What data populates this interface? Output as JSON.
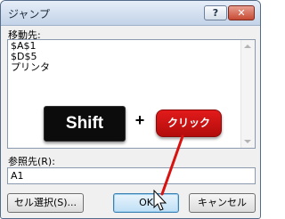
{
  "window": {
    "title": "ジャンプ",
    "help_label": "?",
    "close_label": "✕"
  },
  "goto": {
    "label": "移動先:",
    "items": [
      "$A$1",
      "$D$5",
      "プリンタ"
    ]
  },
  "overlay": {
    "key_label": "Shift",
    "plus": "+",
    "click_label": "クリック",
    "accent": "#d9120f"
  },
  "reference": {
    "label": "参照先(R):",
    "value": "A1"
  },
  "buttons": {
    "special": "セル選択(S)...",
    "ok": "OK",
    "cancel": "キャンセル"
  }
}
